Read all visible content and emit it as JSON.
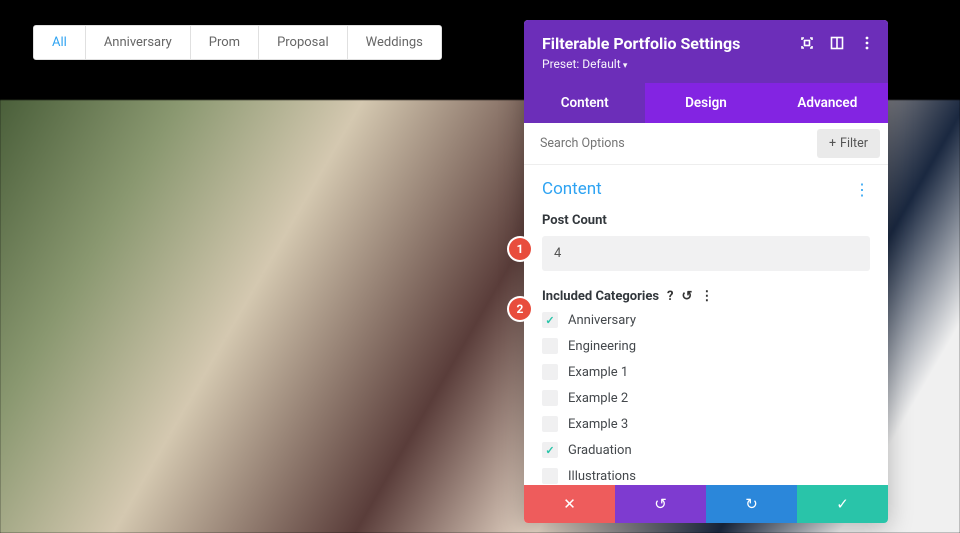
{
  "filter_tabs": [
    "All",
    "Anniversary",
    "Prom",
    "Proposal",
    "Weddings"
  ],
  "filter_active_index": 0,
  "panel": {
    "title": "Filterable Portfolio Settings",
    "preset_label": "Preset: Default",
    "tabs": [
      "Content",
      "Design",
      "Advanced"
    ],
    "active_tab_index": 0,
    "search_placeholder": "Search Options",
    "filter_button": "Filter"
  },
  "section": {
    "title": "Content",
    "post_count_label": "Post Count",
    "post_count_value": "4",
    "included_categories_label": "Included Categories",
    "categories": [
      {
        "label": "Anniversary",
        "checked": true
      },
      {
        "label": "Engineering",
        "checked": false
      },
      {
        "label": "Example 1",
        "checked": false
      },
      {
        "label": "Example 2",
        "checked": false
      },
      {
        "label": "Example 3",
        "checked": false
      },
      {
        "label": "Graduation",
        "checked": true
      },
      {
        "label": "Illustrations",
        "checked": false
      }
    ]
  },
  "badges": {
    "one": "1",
    "two": "2"
  }
}
